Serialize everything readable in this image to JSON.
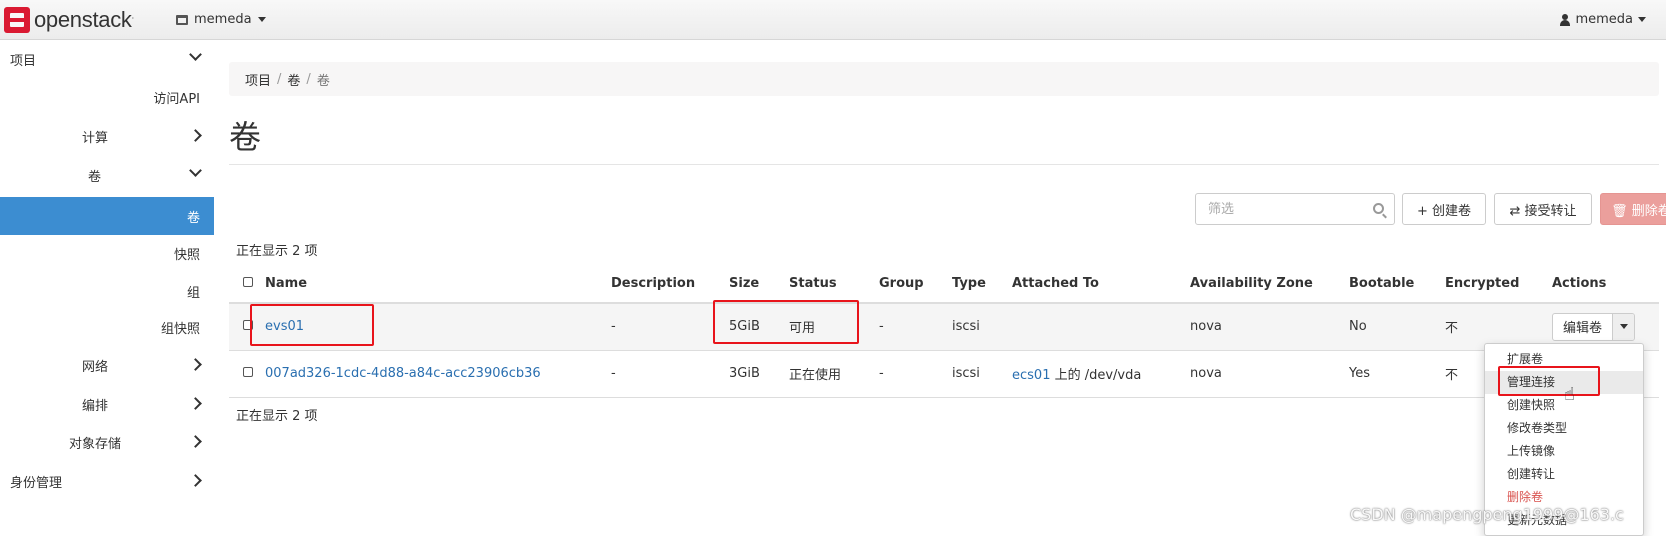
{
  "app": {
    "logo_text": "openstack",
    "project": "memeda",
    "user": "memeda"
  },
  "sidebar": {
    "items": [
      {
        "label": "项目"
      },
      {
        "label": "访问API"
      },
      {
        "label": "计算"
      },
      {
        "label": "卷"
      },
      {
        "label": "卷"
      },
      {
        "label": "快照"
      },
      {
        "label": "组"
      },
      {
        "label": "组快照"
      },
      {
        "label": "网络"
      },
      {
        "label": "编排"
      },
      {
        "label": "对象存储"
      },
      {
        "label": "身份管理"
      }
    ]
  },
  "breadcrumb": [
    "项目",
    "卷",
    "卷"
  ],
  "page_title": "卷",
  "toolbar": {
    "filter_placeholder": "筛选",
    "create_label": "+ 创建卷",
    "accept_transfer_label": "⇄ 接受转让",
    "delete_label": "🗑 删除卷"
  },
  "showing_top": "正在显示 2 项",
  "showing_bottom": "正在显示 2 项",
  "table": {
    "columns": [
      "Name",
      "Description",
      "Size",
      "Status",
      "Group",
      "Type",
      "Attached To",
      "Availability Zone",
      "Bootable",
      "Encrypted",
      "Actions"
    ],
    "rows": [
      {
        "name": "evs01",
        "description": "-",
        "size": "5GiB",
        "status": "可用",
        "group": "-",
        "type": "iscsi",
        "attached_link": "",
        "attached_rest": "",
        "zone": "nova",
        "bootable": "No",
        "encrypted": "不"
      },
      {
        "name": "007ad326-1cdc-4d88-a84c-acc23906cb36",
        "description": "-",
        "size": "3GiB",
        "status": "正在使用",
        "group": "-",
        "type": "iscsi",
        "attached_link": "ecs01",
        "attached_rest": " 上的 /dev/vda",
        "zone": "nova",
        "bootable": "Yes",
        "encrypted": "不"
      }
    ],
    "edit_label": "编辑卷"
  },
  "dropdown": {
    "items": [
      "扩展卷",
      "管理连接",
      "创建快照",
      "修改卷类型",
      "上传镜像",
      "创建转让",
      "删除卷",
      "更新元数据"
    ]
  },
  "watermark": "CSDN @mapengpeng1999@163.c",
  "colors": {
    "accent": "#3c8dd1",
    "danger": "#eb9f9c",
    "link": "#2a6fb0",
    "highlight": "#e8141b"
  }
}
